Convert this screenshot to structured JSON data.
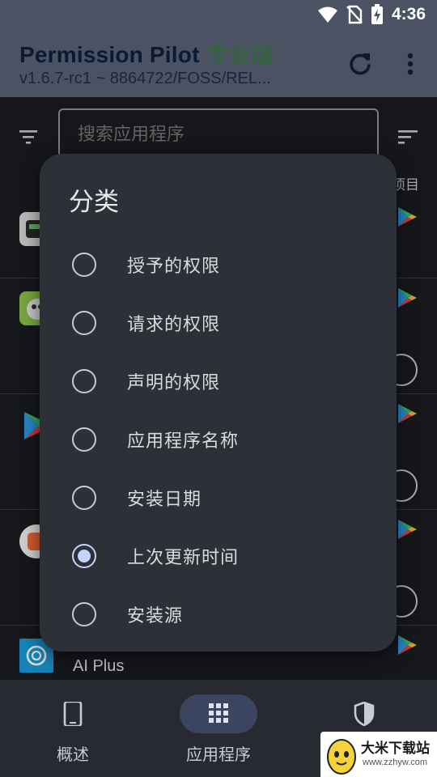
{
  "status_bar": {
    "time": "4:36",
    "icons": [
      "wifi-icon",
      "no-sim-icon",
      "battery-charging-icon"
    ]
  },
  "app_bar": {
    "title": "Permission Pilot",
    "title_suffix": "专业版",
    "version": "v1.6.7-rc1 ~ 8864722/FOSS/REL...",
    "actions": [
      "refresh-icon",
      "more-vert-icon"
    ]
  },
  "search": {
    "placeholder": "搜索应用程序"
  },
  "list_header": {
    "items_label": "项目"
  },
  "app_list": {
    "rows": [
      {
        "icon": "app-icon-1"
      },
      {
        "icon": "app-icon-2"
      },
      {
        "icon": "google-play-icon"
      },
      {
        "icon": "app-icon-4"
      },
      {
        "icon": "chatgpt-icon",
        "label": "AI Plus"
      }
    ]
  },
  "sort_dialog": {
    "title": "分类",
    "options": [
      {
        "label": "授予的权限",
        "selected": false
      },
      {
        "label": "请求的权限",
        "selected": false
      },
      {
        "label": "声明的权限",
        "selected": false
      },
      {
        "label": "应用程序名称",
        "selected": false
      },
      {
        "label": "安装日期",
        "selected": false
      },
      {
        "label": "上次更新时间",
        "selected": true
      },
      {
        "label": "安装源",
        "selected": false
      }
    ]
  },
  "bottom_nav": {
    "items": [
      {
        "label": "概述",
        "icon": "phone-icon",
        "active": false
      },
      {
        "label": "应用程序",
        "icon": "apps-grid-icon",
        "active": true
      },
      {
        "label": "",
        "icon": "shield-icon",
        "active": false
      }
    ]
  },
  "watermark": {
    "name": "大米下载站",
    "url": "www.zzhyw.com"
  },
  "colors": {
    "app_bar": "#4a5263",
    "dialog_bg": "#2e3038",
    "radio_selected": "#c5d4ff",
    "pro_badge": "#2e6b2e"
  }
}
